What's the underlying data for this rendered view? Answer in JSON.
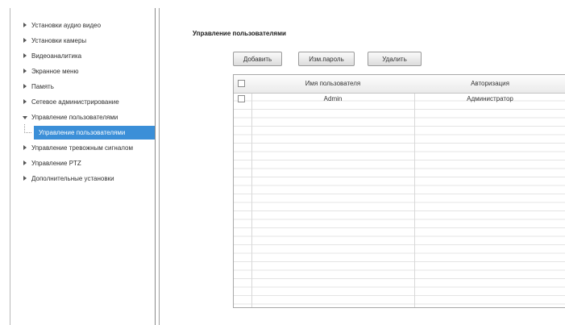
{
  "sidebar": {
    "items": [
      {
        "label": "Установки аудио видео"
      },
      {
        "label": "Установки камеры"
      },
      {
        "label": "Видеоаналитика"
      },
      {
        "label": "Экранное меню"
      },
      {
        "label": "Память"
      },
      {
        "label": "Сетевое администрирование"
      },
      {
        "label": "Управление пользователями"
      },
      {
        "label": "Управление пользователями"
      },
      {
        "label": "Управление тревожным сигналом"
      },
      {
        "label": "Управление PTZ"
      },
      {
        "label": "Дополнительные установки"
      }
    ]
  },
  "main": {
    "title": "Управление пользователями",
    "buttons": {
      "add": "Добавить",
      "change_password": "Изм.пароль",
      "delete": "Удалить"
    },
    "table": {
      "columns": [
        "Имя пользователя",
        "Авторизация"
      ],
      "rows": [
        {
          "name": "Admin",
          "authorization": "Администратор"
        }
      ]
    }
  }
}
